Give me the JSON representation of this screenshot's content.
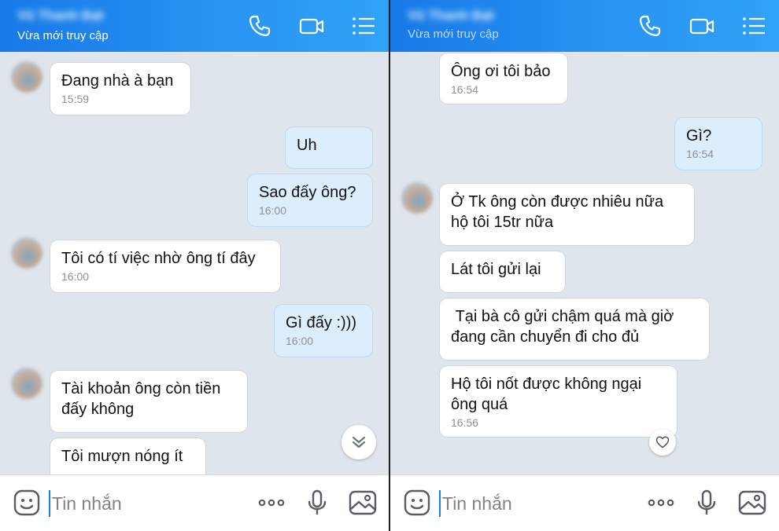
{
  "panels": [
    {
      "header": {
        "contact_name": "Vũ Thanh Đạt",
        "status": "Vừa mới truy cập"
      },
      "messages": [
        {
          "dir": "in",
          "text": "Đang nhà à bạn",
          "time": "15:59"
        },
        {
          "dir": "out",
          "text": "Uh",
          "time": ""
        },
        {
          "dir": "out",
          "text": "Sao đấy ông?",
          "time": "16:00"
        },
        {
          "dir": "in",
          "text": "Tôi có tí việc nhờ ông tí đây",
          "time": "16:00"
        },
        {
          "dir": "out",
          "text": "Gì đấy :)))",
          "time": "16:00"
        },
        {
          "dir": "in",
          "text": "Tài khoản ông còn tiền\nđấy không",
          "time": ""
        },
        {
          "dir": "in",
          "text": "Tôi mượn nóng ít",
          "time": ""
        }
      ],
      "composer": {
        "placeholder": "Tin nhắn"
      }
    },
    {
      "header": {
        "contact_name": "Vũ Thanh Đạt",
        "status": "Vừa mới truy cập"
      },
      "messages": [
        {
          "dir": "in",
          "text": "Ông ơi tôi bảo",
          "time": "16:54"
        },
        {
          "dir": "out",
          "text": "Gì?",
          "time": "16:54"
        },
        {
          "dir": "in",
          "text": "Ở Tk ông còn được nhiêu nữa\nhộ tôi 15tr nữa",
          "time": ""
        },
        {
          "dir": "in",
          "text": "Lát tôi gửi lại",
          "time": ""
        },
        {
          "dir": "in",
          "text": " Tại bà cô gửi chậm quá mà giờ\nđang cần chuyển đi cho đủ",
          "time": ""
        },
        {
          "dir": "in",
          "text": "Hộ tôi nốt được không ngại\nông quá",
          "time": "16:56"
        }
      ],
      "composer": {
        "placeholder": "Tin nhắn"
      }
    }
  ],
  "icons": {
    "call": "phone-icon",
    "video": "video-call-icon",
    "menu": "list-menu-icon",
    "emoji": "emoji-icon",
    "more": "more-dots-icon",
    "mic": "microphone-icon",
    "image": "image-icon",
    "scroll": "scroll-down-icon",
    "reaction": "heart-icon"
  },
  "colors": {
    "header_start": "#1779e8",
    "header_end": "#2ea3f5",
    "chat_bg": "#dfe5ec",
    "bubble_out": "#dcedfb",
    "bubble_in": "#ffffff",
    "caret": "#1a7cf0"
  }
}
